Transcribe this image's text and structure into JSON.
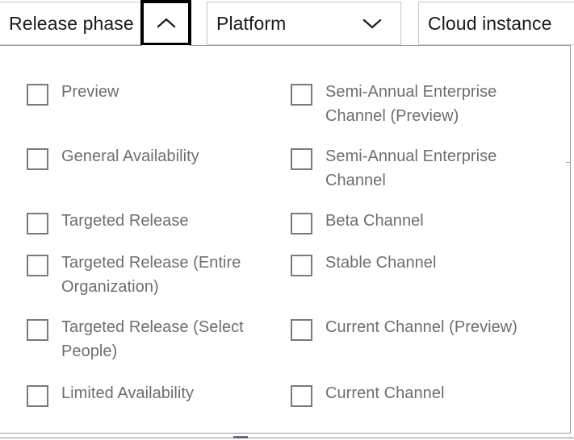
{
  "filter_bar": {
    "filters": [
      {
        "label": "Release phase",
        "icon": "chevron-up-icon",
        "expanded": true,
        "focused": true
      },
      {
        "label": "Platform",
        "icon": "chevron-down-icon",
        "expanded": false,
        "focused": false
      },
      {
        "label": "Cloud instance",
        "icon": "",
        "expanded": false,
        "focused": false
      }
    ]
  },
  "dropdown": {
    "owner": "Release phase",
    "columns": {
      "left": [
        {
          "label": "Preview",
          "checked": false
        },
        {
          "label": "General Availability",
          "checked": false
        },
        {
          "label": "Targeted Release",
          "checked": false
        },
        {
          "label": "Targeted Release (Entire Organization)",
          "checked": false
        },
        {
          "label": "Targeted Release (Select People)",
          "checked": false
        },
        {
          "label": "Limited Availability",
          "checked": false
        }
      ],
      "right": [
        {
          "label": "Semi-Annual Enterprise Channel (Preview)",
          "checked": false
        },
        {
          "label": "Semi-Annual Enterprise Channel",
          "checked": false
        },
        {
          "label": "Beta Channel",
          "checked": false
        },
        {
          "label": "Stable Channel",
          "checked": false
        },
        {
          "label": "Current Channel (Preview)",
          "checked": false
        },
        {
          "label": "Current Channel",
          "checked": false
        }
      ]
    }
  },
  "colors": {
    "panel_border": "#9b9b9b",
    "filter_border": "#c8c8c8",
    "focus_border": "#000000",
    "label_text": "#1a1a1a",
    "option_text": "#6e6e6e",
    "checkbox_border": "#7a7a7a",
    "background": "#ffffff"
  }
}
